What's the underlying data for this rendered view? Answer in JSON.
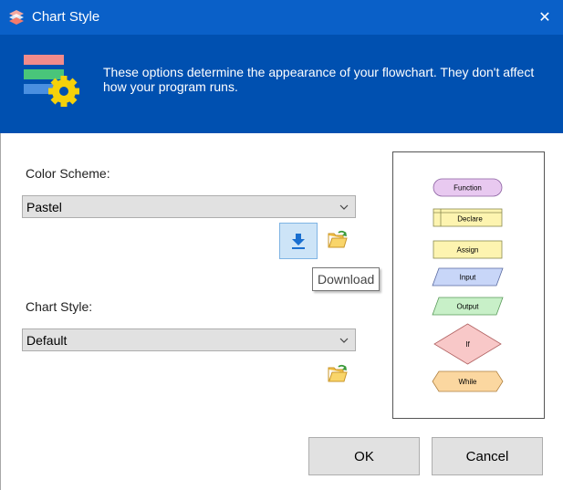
{
  "window": {
    "title": "Chart Style",
    "close_glyph": "✕"
  },
  "banner": {
    "icon": "chart-style-gear-icon",
    "description": "These options determine the appearance of your flowchart. They don't affect how your program runs."
  },
  "color_scheme": {
    "label": "Color Scheme:",
    "selected": "Pastel"
  },
  "chart_style": {
    "label": "Chart Style:",
    "selected": "Default"
  },
  "tooltip": {
    "text": "Download"
  },
  "preview": {
    "shapes": {
      "function": "Function",
      "declare": "Declare",
      "assign": "Assign",
      "input": "Input",
      "output": "Output",
      "if": "If",
      "while": "While"
    }
  },
  "buttons": {
    "ok": "OK",
    "cancel": "Cancel"
  },
  "colors": {
    "titlebar": "#0a60c8",
    "banner": "#0050b0",
    "function": "#e8c9f0",
    "declare": "#fdf4b0",
    "assign": "#fdf4b0",
    "input": "#c8d6f8",
    "output": "#c8f0c8",
    "if": "#f8c8c8",
    "while": "#fbd7a0"
  }
}
